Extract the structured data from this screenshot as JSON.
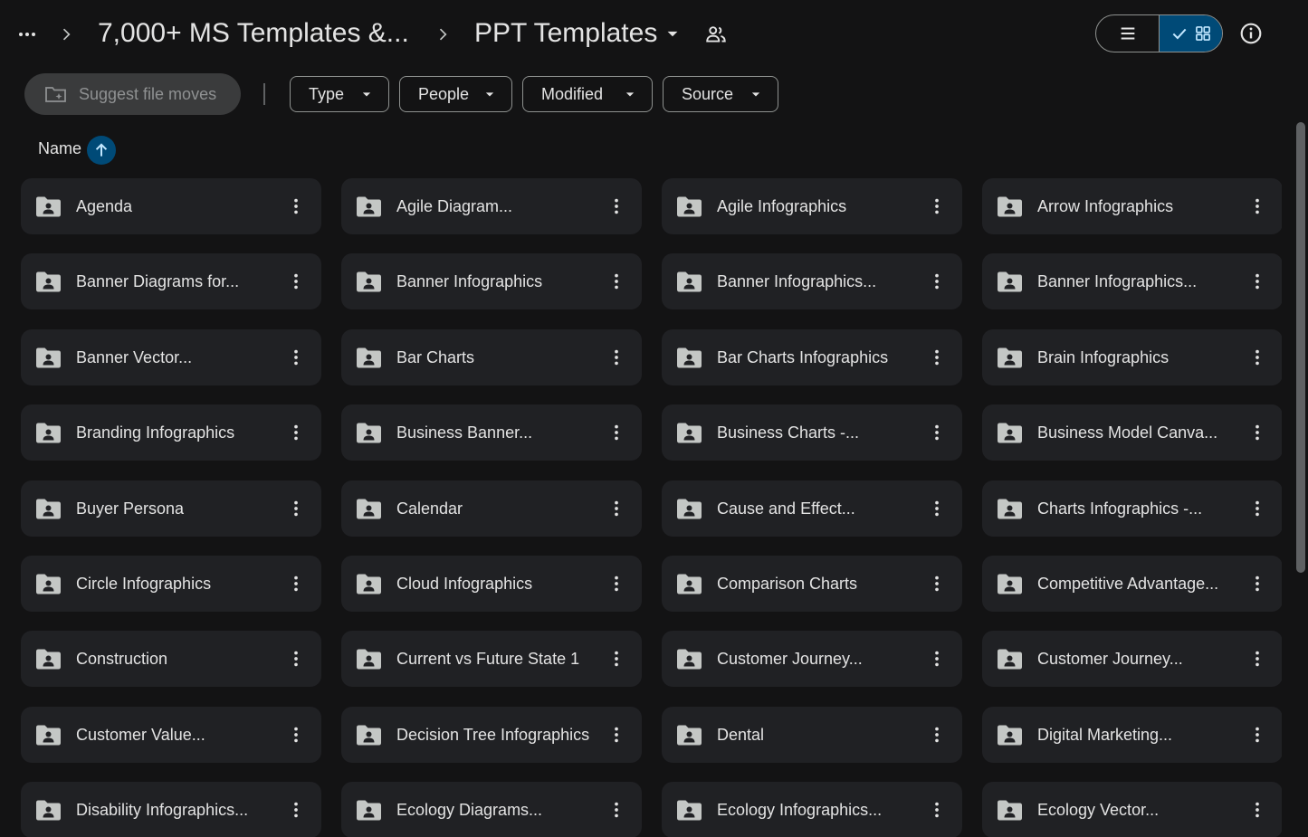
{
  "breadcrumb": {
    "more_icon": "more-horiz-icon",
    "separator_icon": "chevron-right-icon",
    "parent": "7,000+ MS Templates &...",
    "current": "PPT Templates",
    "current_dropdown_icon": "arrow-drop-down-icon",
    "shared_icon": "people-icon"
  },
  "view_toggle": {
    "list_icon": "list-view-icon",
    "grid_icon": "grid-view-icon",
    "active": "grid",
    "check_icon": "check-icon"
  },
  "info_icon": "info-icon",
  "filters": {
    "suggest_label": "Suggest file moves",
    "suggest_icon": "folder-suggest-icon",
    "suggest_disabled": true,
    "chips": [
      {
        "label": "Type"
      },
      {
        "label": "People"
      },
      {
        "label": "Modified"
      },
      {
        "label": "Source"
      }
    ],
    "chip_icon": "arrow-drop-down-icon"
  },
  "sort": {
    "label": "Name",
    "direction_icon": "arrow-up-icon"
  },
  "folder_icon": "shared-folder-icon",
  "more_icon": "more-vert-icon",
  "folders": [
    "Agenda",
    "Agile Diagram...",
    "Agile Infographics",
    "Arrow Infographics",
    "Banner Diagrams for...",
    "Banner Infographics",
    "Banner Infographics...",
    "Banner Infographics...",
    "Banner Vector...",
    "Bar Charts",
    "Bar Charts Infographics",
    "Brain Infographics",
    "Branding Infographics",
    "Business Banner...",
    "Business Charts -...",
    "Business Model Canva...",
    "Buyer Persona",
    "Calendar",
    "Cause and Effect...",
    "Charts Infographics -...",
    "Circle Infographics",
    "Cloud Infographics",
    "Comparison Charts",
    "Competitive Advantage...",
    "Construction",
    "Current vs Future State 1",
    "Customer Journey...",
    "Customer Journey...",
    "Customer Value...",
    "Decision Tree Infographics",
    "Dental",
    "Digital Marketing...",
    "Disability Infographics...",
    "Ecology Diagrams...",
    "Ecology Infographics...",
    "Ecology Vector..."
  ],
  "colors": {
    "background": "#131314",
    "card": "#202124",
    "accent": "#004a77",
    "text": "#e3e3e3",
    "outline": "#8e918f"
  }
}
